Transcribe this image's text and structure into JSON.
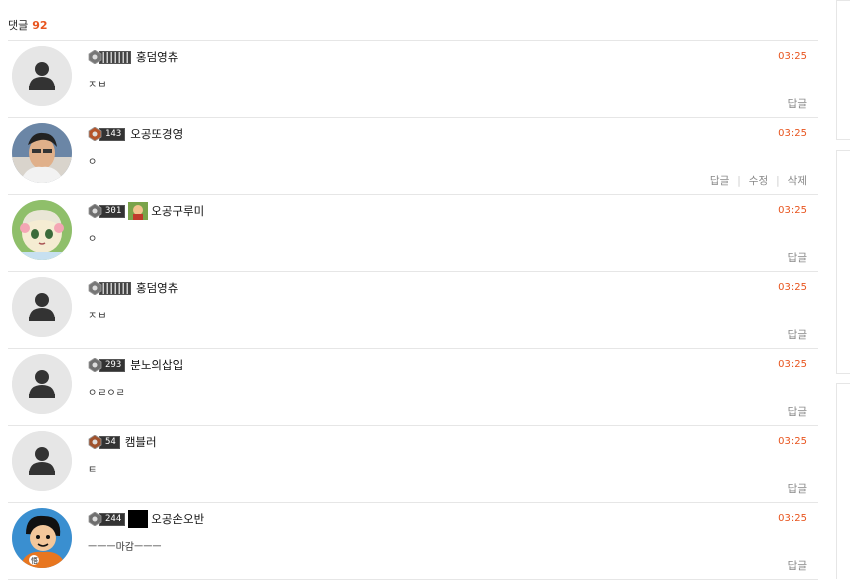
{
  "header": {
    "label": "댓글",
    "count": "92"
  },
  "comments": [
    {
      "avatar": "default-avatar-icon",
      "level": "",
      "level_style": "noisy",
      "gem_color": "#777777",
      "nickname": "홍덤영츄",
      "time": "03:25",
      "text": "ㅈㅂ",
      "actions": [
        "답글"
      ]
    },
    {
      "avatar": "photo-avatar-man",
      "level": "143",
      "level_style": "normal",
      "gem_color": "#b5542a",
      "nickname": "오공또경영",
      "time": "03:25",
      "text": "ㅇ",
      "actions": [
        "답글",
        "수정",
        "삭제"
      ]
    },
    {
      "avatar": "anime-avatar-girl",
      "level": "301",
      "level_style": "normal",
      "gem_color": "#6f6f6f",
      "extra_icon": "game-character-icon",
      "nickname": "오공구루미",
      "time": "03:25",
      "text": "ㅇ",
      "actions": [
        "답글"
      ]
    },
    {
      "avatar": "default-avatar-icon",
      "level": "",
      "level_style": "noisy",
      "gem_color": "#777777",
      "nickname": "홍덤영츄",
      "time": "03:25",
      "text": "ㅈㅂ",
      "actions": [
        "답글"
      ]
    },
    {
      "avatar": "default-avatar-icon",
      "level": "293",
      "level_style": "normal",
      "gem_color": "#6f6f6f",
      "nickname": "분노의삽입",
      "time": "03:25",
      "text": "ㅇㄹㅇㄹ",
      "actions": [
        "답글"
      ]
    },
    {
      "avatar": "default-avatar-icon",
      "level": "54",
      "level_style": "normal",
      "gem_color": "#a0522d",
      "nickname": "캠블러",
      "time": "03:25",
      "text": "ㅌ",
      "actions": [
        "답글"
      ]
    },
    {
      "avatar": "cartoon-avatar-boy",
      "level": "244",
      "level_style": "normal",
      "gem_color": "#6f6f6f",
      "extra_icon": "black-square-icon",
      "nickname": "오공손오반",
      "time": "03:25",
      "text": "ㅡㅡㅡ마감ㅡㅡㅡ",
      "actions": [
        "답글"
      ]
    }
  ]
}
